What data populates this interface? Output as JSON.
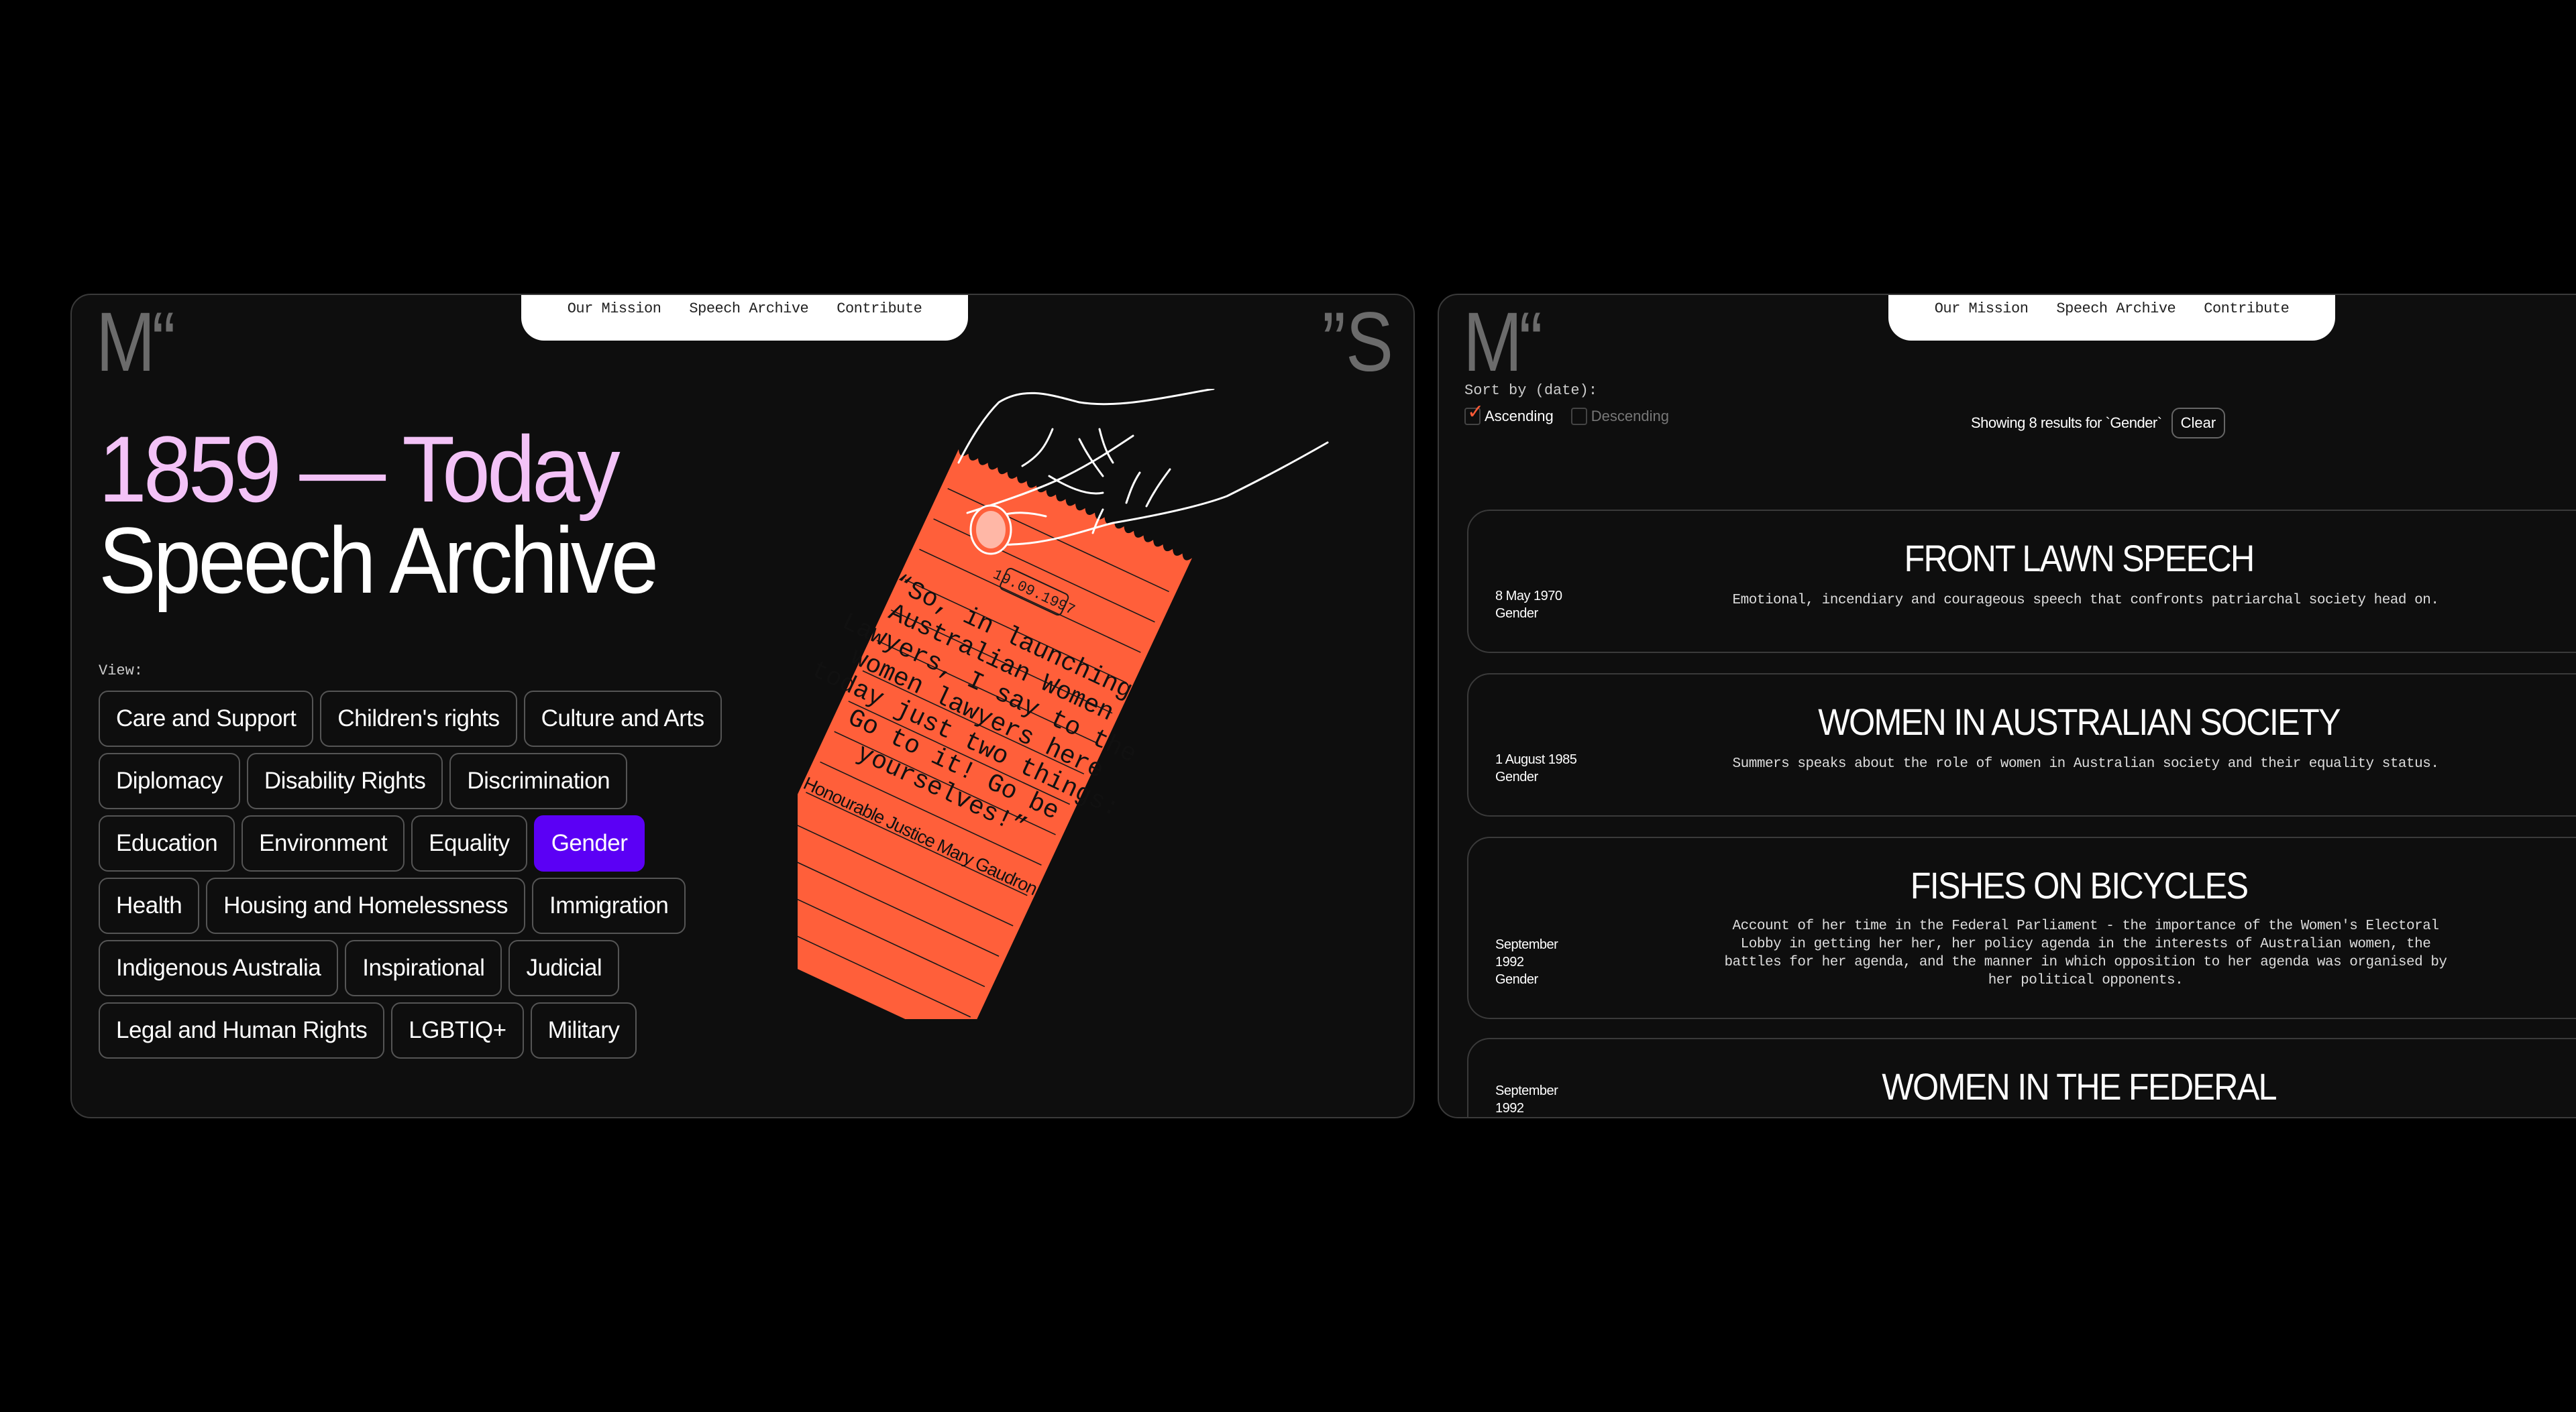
{
  "nav": {
    "items": [
      "Our Mission",
      "Speech Archive",
      "Contribute"
    ]
  },
  "logo": {
    "left_mark": "M“",
    "right_mark": "”S"
  },
  "hero": {
    "line1": "1859 — Today",
    "line2": "Speech Archive"
  },
  "filters": {
    "label": "View:",
    "selected": "Gender",
    "tags": [
      "Care and Support",
      "Children's rights",
      "Culture and Arts",
      "Diplomacy",
      "Disability Rights",
      "Discrimination",
      "Education",
      "Environment",
      "Equality",
      "Gender",
      "Health",
      "Housing and Homelessness",
      "Immigration",
      "Indigenous Australia",
      "Inspirational",
      "Judicial",
      "Legal and Human Rights",
      "LGBTIQ+",
      "Military"
    ]
  },
  "featured_quote": {
    "date": "19.09.1997",
    "lines": [
      "“So, in launching",
      "Australian Women",
      "Lawyers, I say to the",
      "women lawyers here",
      "today just two things:",
      "Go to it! Go be",
      "yourselves!”"
    ],
    "author": "Honourable Justice Mary Gaudron"
  },
  "sort": {
    "label": "Sort by (date):",
    "options": [
      {
        "label": "Ascending",
        "checked": true
      },
      {
        "label": "Descending",
        "checked": false
      }
    ]
  },
  "results": {
    "summary": "Showing 8 results for `Gender`",
    "clear_label": "Clear"
  },
  "speeches": [
    {
      "title": "FRONT LAWN SPEECH",
      "date": "8 May 1970",
      "category": "Gender",
      "description": "Emotional, incendiary and courageous speech that confronts patriarchal society head on."
    },
    {
      "title": "WOMEN IN AUSTRALIAN SOCIETY",
      "date": "1 August 1985",
      "category": "Gender",
      "description": "Summers speaks about the role of women in Australian society and their equality status."
    },
    {
      "title": "FISHES ON BICYCLES",
      "date": "September 1992",
      "category": "Gender",
      "description": "Account of her time in the Federal Parliament - the importance of the Women's Electoral Lobby in getting her her, her policy agenda in the interests of Australian women, the battles for her agenda, and the manner in which opposition to her agenda was organised by her political opponents."
    },
    {
      "title": "WOMEN IN THE FEDERAL PARLIAMENT",
      "date": "September 1992",
      "category": "",
      "description": ""
    }
  ],
  "colors": {
    "accent_selected": "#5b00f5",
    "hero_pink": "#f3c2f7",
    "note_orange": "#ff5f3a",
    "check_red": "#ff5a36"
  }
}
